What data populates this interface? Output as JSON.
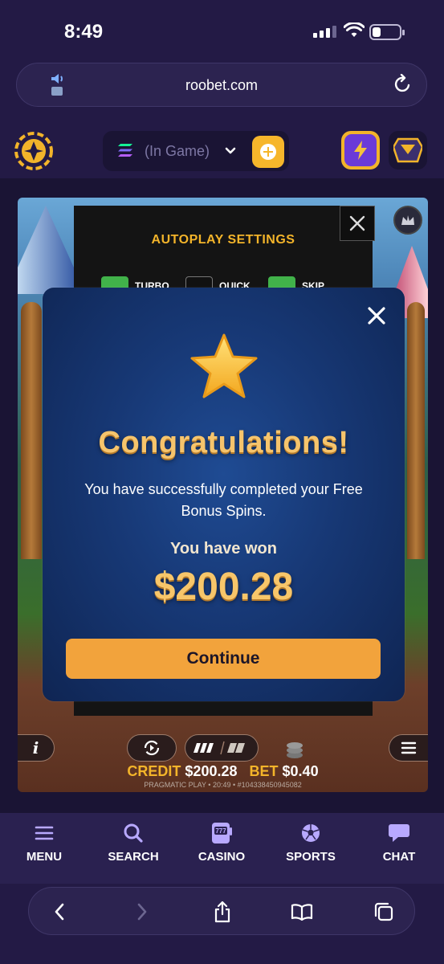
{
  "status_bar": {
    "time": "8:49"
  },
  "browser": {
    "url": "roobet.com"
  },
  "header": {
    "balance_label": "(In Game)"
  },
  "game": {
    "settings_title": "AUTOPLAY SETTINGS",
    "options": [
      {
        "label": "TURBO",
        "checked": true
      },
      {
        "label": "QUICK",
        "checked": false
      },
      {
        "label": "SKIP",
        "checked": true
      }
    ],
    "info_label": "i",
    "credit_label": "CREDIT",
    "credit_value": "$200.28",
    "bet_label": "BET",
    "bet_value": "$0.40",
    "footer": "PRAGMATIC PLAY • 20:49 • #104338450945082"
  },
  "modal": {
    "title": "Congratulations!",
    "message": "You have successfully completed your Free Bonus Spins.",
    "won_label": "You have won",
    "won_amount": "$200.28",
    "continue_label": "Continue"
  },
  "bottom_nav": {
    "items": [
      {
        "label": "MENU",
        "icon": "hamburger-icon"
      },
      {
        "label": "SEARCH",
        "icon": "search-icon"
      },
      {
        "label": "CASINO",
        "icon": "slot-machine-icon"
      },
      {
        "label": "SPORTS",
        "icon": "soccer-ball-icon"
      },
      {
        "label": "CHAT",
        "icon": "chat-bubble-icon"
      }
    ]
  },
  "colors": {
    "background": "#231a45",
    "accent": "#f6b62b",
    "modal": "#173875",
    "continue_button": "#f2a33c",
    "checkbox_on": "#41b24a"
  }
}
